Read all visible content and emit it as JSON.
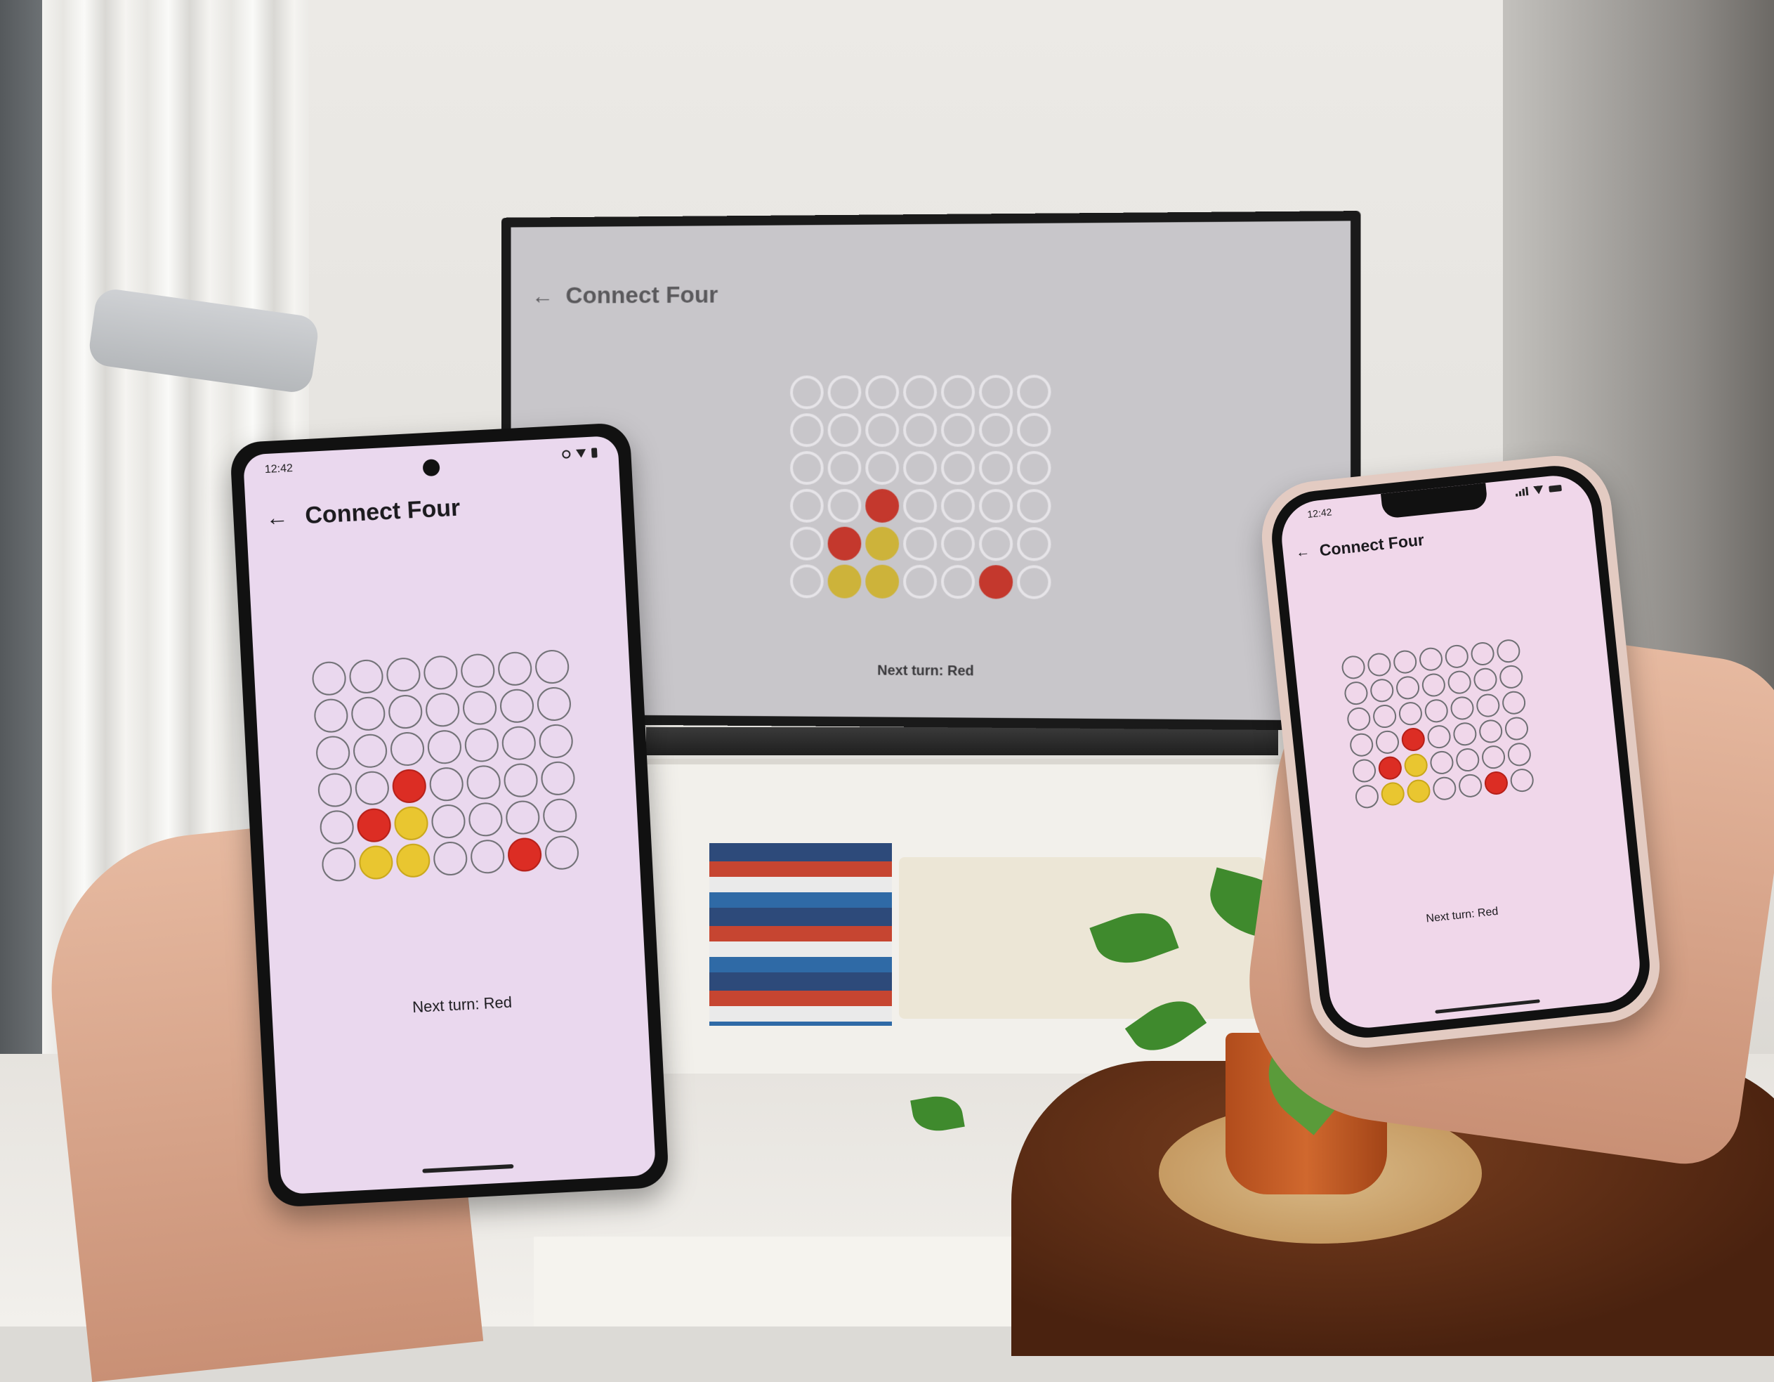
{
  "tv": {
    "title": "Connect Four",
    "back_icon": "back-arrow-icon",
    "status": "Next turn: Red"
  },
  "android": {
    "time": "12:42",
    "title": "Connect Four",
    "back_icon": "back-arrow-icon",
    "status": "Next turn: Red"
  },
  "iphone": {
    "time": "12:42",
    "title": "Connect Four",
    "back_icon": "back-arrow-icon",
    "status": "Next turn: Red"
  },
  "game": {
    "rows": 6,
    "columns": 7,
    "pieces": [
      {
        "row": 4,
        "col": 3,
        "color": "red"
      },
      {
        "row": 5,
        "col": 2,
        "color": "red"
      },
      {
        "row": 5,
        "col": 3,
        "color": "yellow"
      },
      {
        "row": 6,
        "col": 2,
        "color": "yellow"
      },
      {
        "row": 6,
        "col": 3,
        "color": "yellow"
      },
      {
        "row": 6,
        "col": 6,
        "color": "red"
      }
    ],
    "colors": {
      "red": "#dc2d24",
      "yellow": "#e9c630"
    }
  }
}
